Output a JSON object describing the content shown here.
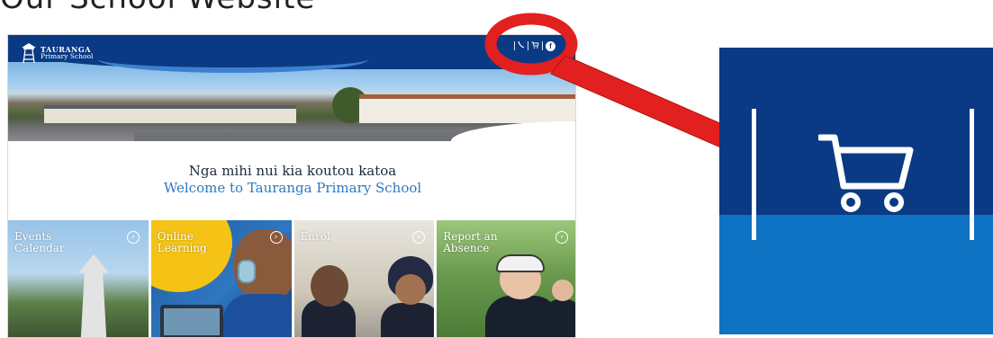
{
  "slide": {
    "title": "Our School Website"
  },
  "site": {
    "logo": {
      "line1": "TAURANGA",
      "line2": "Primary School",
      "icon": "bell-tower-icon"
    },
    "utility_icons": [
      "phone-icon",
      "cart-icon",
      "facebook-icon"
    ],
    "facebook_glyph": "f",
    "welcome_line1": "Nga mihi nui  kia koutou katoa",
    "welcome_line2": "Welcome to Tauranga  Primary School",
    "tiles": [
      {
        "label": "Events Calendar",
        "icon": "arrow-circle-icon"
      },
      {
        "label": "Online Learning",
        "icon": "arrow-circle-icon"
      },
      {
        "label": "Enrol",
        "icon": "arrow-circle-icon"
      },
      {
        "label": "Report an Absence",
        "icon": "arrow-circle-icon"
      }
    ],
    "colors": {
      "header_blue": "#0b3a84",
      "accent_blue": "#2c79c2",
      "highlight_yellow": "#f4c316"
    }
  },
  "annotation": {
    "color": "#e2201f",
    "shapes": [
      "highlight-circle",
      "pointer-arrow"
    ]
  },
  "zoom_inset": {
    "icon": "cart-icon",
    "colors": {
      "top": "#0b3a84",
      "bottom": "#0e73c2"
    }
  }
}
